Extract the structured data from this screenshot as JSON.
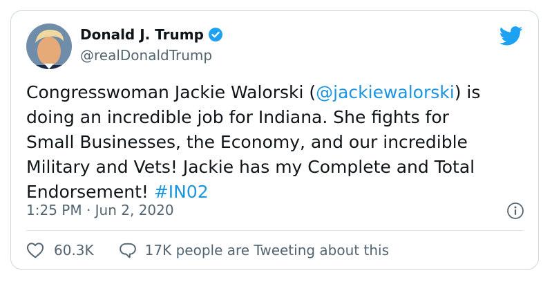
{
  "tweet": {
    "display_name": "Donald J. Trump",
    "handle": "@realDonaldTrump",
    "text": {
      "line1_a": "Congresswoman Jackie Walorski (",
      "line1_mention": "@jackiewalorski",
      "line1_b": ") is",
      "line2": "doing an incredible job for Indiana. She fights for",
      "line3": "Small Businesses, the Economy, and our incredible",
      "line4": "Military and Vets! Jackie has my Complete and Total",
      "line5_a": "Endorsement! ",
      "line5_hashtag": "#IN02"
    },
    "timestamp": "1:25 PM · Jun 2, 2020",
    "likes": "60.3K",
    "tweeting_about": "17K people are Tweeting about this"
  },
  "icons": {
    "avatar": "profile-photo",
    "verified": "verified-badge-icon",
    "brand": "twitter-bird-icon",
    "info": "info-icon",
    "like": "heart-icon",
    "reply": "speech-bubble-icon"
  },
  "colors": {
    "accent": "#1da1f2",
    "link": "#1b95e0",
    "text": "#0f1419",
    "muted": "#536471",
    "border": "#cfd9de"
  }
}
